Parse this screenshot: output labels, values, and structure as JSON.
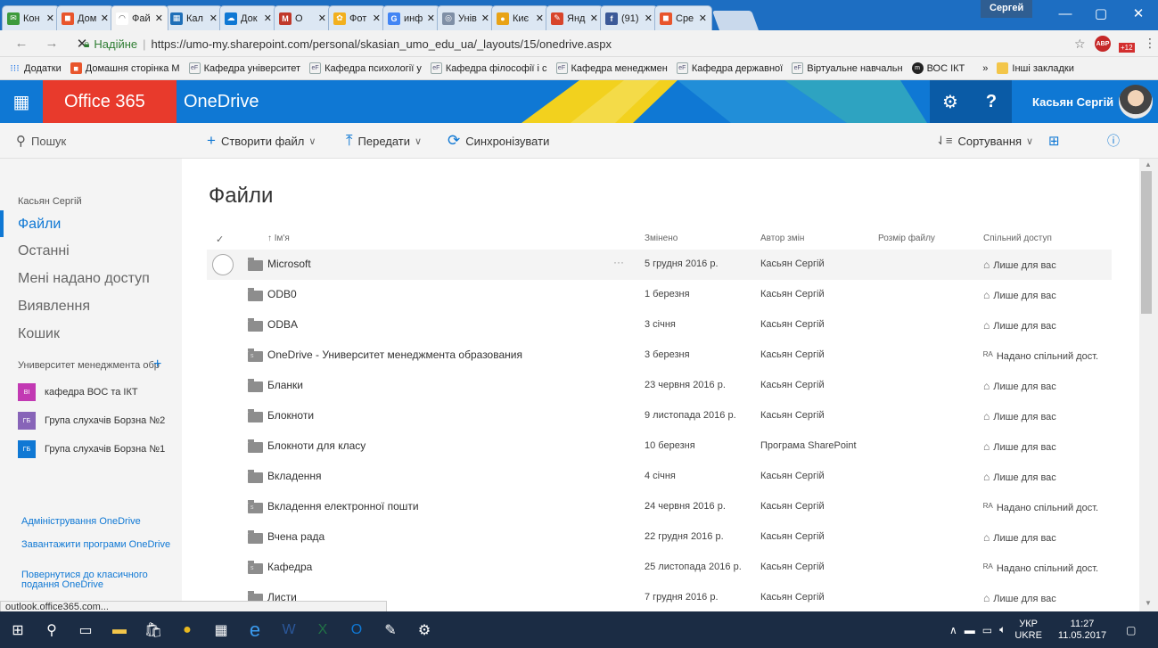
{
  "browser": {
    "tabs": [
      {
        "label": "Кон",
        "icon_color": "#3c9a3c",
        "icon_glyph": "✉"
      },
      {
        "label": "Дом",
        "icon_color": "#e8552c",
        "icon_glyph": "◼"
      },
      {
        "label": "Фай",
        "icon_color": "#ffffff",
        "icon_glyph": "◠",
        "active": true
      },
      {
        "label": "Кал",
        "icon_color": "#1f6fb8",
        "icon_glyph": "▦"
      },
      {
        "label": "Док",
        "icon_color": "#0f78d4",
        "icon_glyph": "☁"
      },
      {
        "label": "О",
        "icon_color": "#c0392b",
        "icon_glyph": "M"
      },
      {
        "label": "Фот",
        "icon_color": "#f2b01e",
        "icon_glyph": "✿"
      },
      {
        "label": "инф",
        "icon_color": "#4285f4",
        "icon_glyph": "G"
      },
      {
        "label": "Унів",
        "icon_color": "#7f8fa6",
        "icon_glyph": "◎"
      },
      {
        "label": "Киє",
        "icon_color": "#e8a317",
        "icon_glyph": "●"
      },
      {
        "label": "Янд",
        "icon_color": "#d8452b",
        "icon_glyph": "✎"
      },
      {
        "label": "(91)",
        "icon_color": "#3b5998",
        "icon_glyph": "f"
      },
      {
        "label": "Сре",
        "icon_color": "#e8552c",
        "icon_glyph": "◼"
      }
    ],
    "profile_name": "Сергей",
    "secure_label": "Надійне",
    "url": "https://umo-my.sharepoint.com/personal/skasian_umo_edu_ua/_layouts/15/onedrive.aspx",
    "bookmarks": [
      "Додатки",
      "Домашня сторінка М",
      "Кафедра університет",
      "Кафедра психології у",
      "Кафедра філософії і с",
      "Кафедра менеджмен",
      "Кафедра державної",
      "Віртуальне навчальн",
      "ВОС ІКТ"
    ],
    "bookmarks_more": "»",
    "other_bookmarks": "Інші закладки",
    "status_url": "outlook.office365.com...",
    "ext_badge": "+12"
  },
  "suite": {
    "brand": "Office 365",
    "app": "OneDrive",
    "user": "Касьян Сергій",
    "settings_glyph": "⚙",
    "help_glyph": "?"
  },
  "commands": {
    "search": "Пошук",
    "new": "Створити файл",
    "upload": "Передати",
    "sync": "Синхронізувати",
    "sort": "Сортування"
  },
  "nav": {
    "user": "Касьян Сергій",
    "items": [
      "Файли",
      "Останні",
      "Мені надано доступ",
      "Виявлення",
      "Кошик"
    ],
    "group_header": "Университет менеджмента обр",
    "groups": [
      {
        "badge": "ВІ",
        "label": "кафедра ВОС та ІКТ",
        "color": "#c239b3"
      },
      {
        "badge": "ГБ",
        "label": "Група слухачів Борзна №2",
        "color": "#8764b8"
      },
      {
        "badge": "ГБ",
        "label": "Група слухачів Борзна №1",
        "color": "#0f78d4"
      }
    ],
    "links": [
      "Адміністрування OneDrive",
      "Завантажити програми OneDrive",
      "Повернутися до класичного подання OneDrive"
    ]
  },
  "files": {
    "title": "Файли",
    "columns": {
      "name": "Ім'я",
      "modified": "Змінено",
      "author": "Автор змін",
      "size": "Розмір файлу",
      "sharing": "Спільний доступ"
    },
    "rows": [
      {
        "name": "Microsoft",
        "modified": "5 грудня 2016 р.",
        "author": "Касьян Сергій",
        "sharing": "Лише для вас",
        "shared": false
      },
      {
        "name": "ODB0",
        "modified": "1 березня",
        "author": "Касьян Сергій",
        "sharing": "Лише для вас",
        "shared": false
      },
      {
        "name": "ODBA",
        "modified": "3 січня",
        "author": "Касьян Сергій",
        "sharing": "Лише для вас",
        "shared": false
      },
      {
        "name": "OneDrive - Университет менеджмента образования",
        "modified": "3 березня",
        "author": "Касьян Сергій",
        "sharing": "Надано спільний дост.",
        "shared": true
      },
      {
        "name": "Бланки",
        "modified": "23 червня 2016 р.",
        "author": "Касьян Сергій",
        "sharing": "Лише для вас",
        "shared": false
      },
      {
        "name": "Блокноти",
        "modified": "9 листопада 2016 р.",
        "author": "Касьян Сергій",
        "sharing": "Лише для вас",
        "shared": false
      },
      {
        "name": "Блокноти для класу",
        "modified": "10 березня",
        "author": "Програма SharePoint",
        "sharing": "Лише для вас",
        "shared": false
      },
      {
        "name": "Вкладення",
        "modified": "4 січня",
        "author": "Касьян Сергій",
        "sharing": "Лише для вас",
        "shared": false
      },
      {
        "name": "Вкладення електронної пошти",
        "modified": "24 червня 2016 р.",
        "author": "Касьян Сергій",
        "sharing": "Надано спільний дост.",
        "shared": true
      },
      {
        "name": "Вчена рада",
        "modified": "22 грудня 2016 р.",
        "author": "Касьян Сергій",
        "sharing": "Лише для вас",
        "shared": false
      },
      {
        "name": "Кафедра",
        "modified": "25 листопада 2016 р.",
        "author": "Касьян Сергій",
        "sharing": "Надано спільний дост.",
        "shared": true
      },
      {
        "name": "Листи",
        "modified": "7 грудня 2016 р.",
        "author": "Касьян Сергій",
        "sharing": "Лише для вас",
        "shared": false
      }
    ]
  },
  "taskbar": {
    "lang": "УКР",
    "lang2": "UKRE",
    "time": "11:27",
    "date": "11.05.2017"
  }
}
